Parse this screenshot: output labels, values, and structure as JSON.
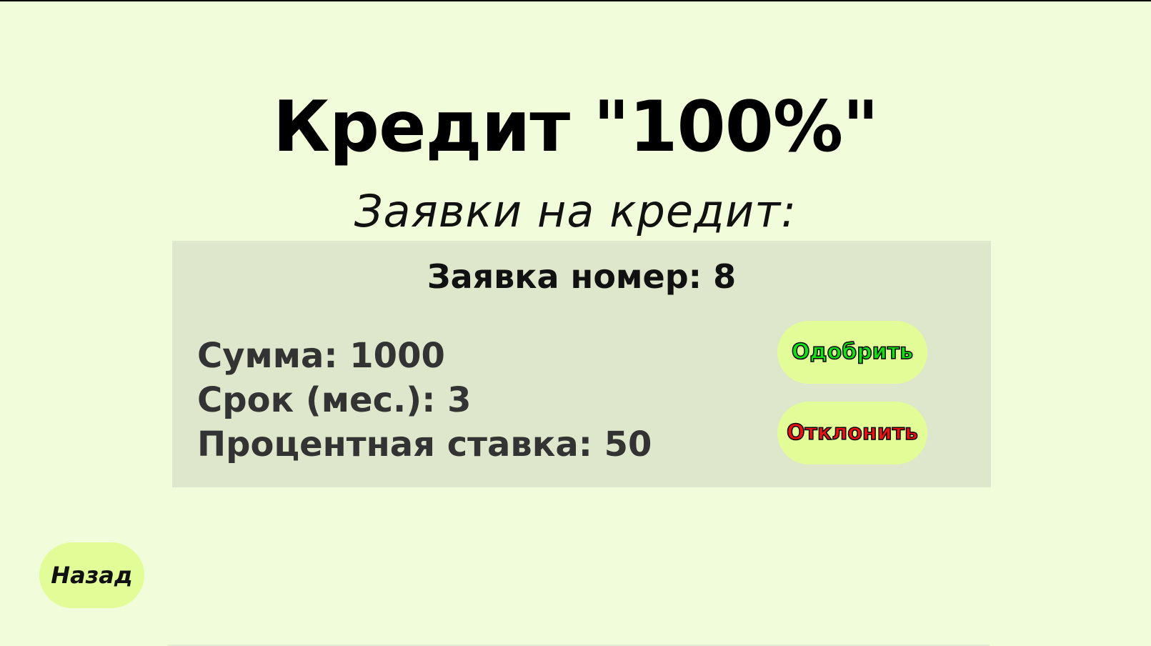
{
  "header": {
    "app_title": "Кредит \"100%\"",
    "section_title": "Заявки на кредит:"
  },
  "application": {
    "title": "Заявка номер: 8",
    "details": [
      "Сумма: 1000",
      "Срок (мес.): 3",
      "Процентная ставка: 50"
    ],
    "approve_label": "Одобрить",
    "reject_label": "Отклонить"
  },
  "navigation": {
    "back_label": "Назад"
  },
  "colors": {
    "background": "#f1fdda",
    "card_background": "#dee6cb",
    "button_background": "#e2fd98",
    "approve_text": "#12e012",
    "reject_text": "#ee1111"
  }
}
